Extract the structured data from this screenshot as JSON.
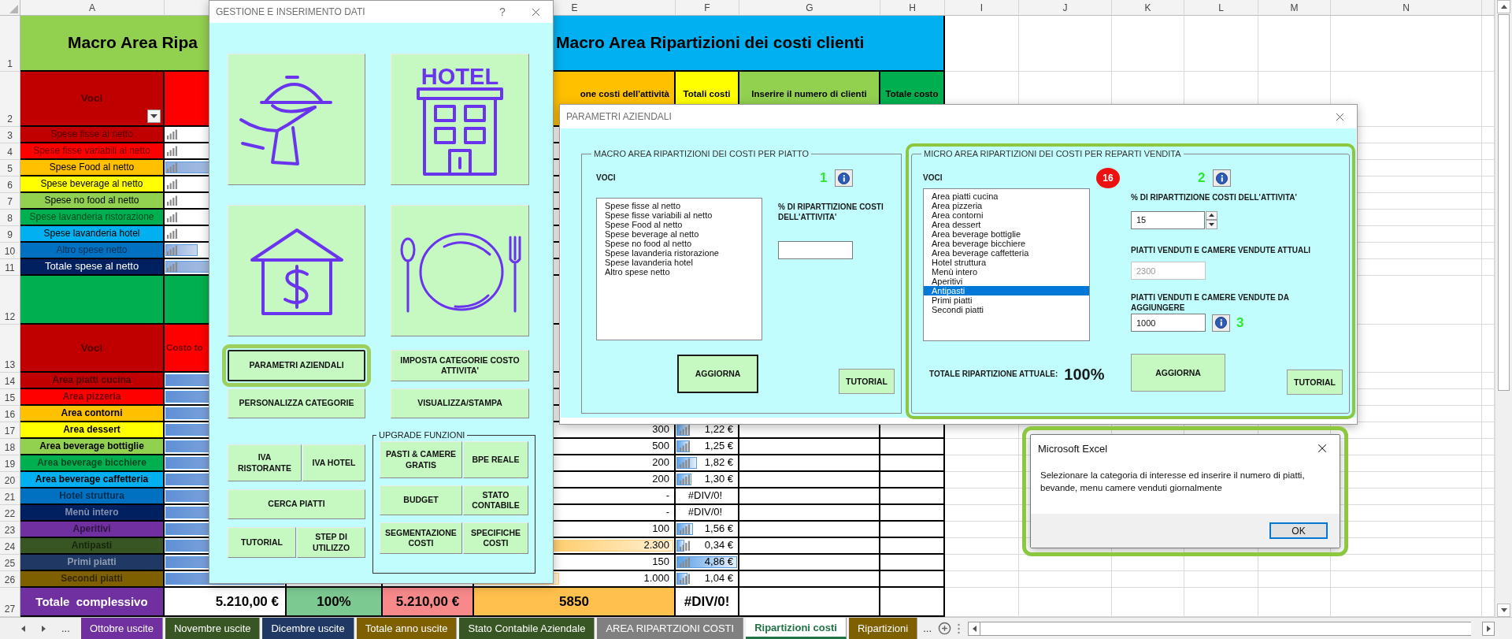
{
  "sheet": {
    "column_headers": {
      "a": "A",
      "e": "E",
      "f": "F",
      "g": "G",
      "h": "H",
      "i": "I",
      "j": "J",
      "k": "K",
      "l": "L",
      "m": "M",
      "n": "N"
    },
    "rows": [
      {
        "number": "1",
        "cells": {
          "a": {
            "kind": "title",
            "text": "Macro Area Ripa",
            "color": "#92d050"
          },
          "b": {
            "color": "#92d050"
          },
          "e": {
            "kind": "title",
            "text": "Macro Area Ripartizioni dei costi clienti",
            "color": "#00b0f0"
          },
          "f": {
            "color": "#00b0f0"
          },
          "g": {
            "color": "#00b0f0"
          },
          "h": {
            "color": "#00b0f0"
          }
        }
      },
      {
        "number": "2",
        "cells": {
          "a": {
            "kind": "head",
            "text": "Voci",
            "color": "#c00000",
            "filter": true
          },
          "b": {
            "color": "#ff0000"
          },
          "e": {
            "kind": "head",
            "text": "one costi dell'attività",
            "color": "#ffc000"
          },
          "f": {
            "kind": "head",
            "text": "Totali costi",
            "color": "#ffff00"
          },
          "g": {
            "kind": "head",
            "text": "Inserire il numero di clienti",
            "color": "#92d050"
          },
          "h": {
            "kind": "head",
            "text": "Totale costo",
            "color": "#00b050"
          }
        }
      },
      {
        "number": "3",
        "cells": {
          "a": {
            "kind": "expense",
            "text": "Spese fisse al netto",
            "color": "#c00000"
          },
          "b": {
            "kind": "bar"
          }
        }
      },
      {
        "number": "4",
        "cells": {
          "a": {
            "kind": "expense",
            "text": "Spese fisse variabili al netto",
            "color": "#ff0000"
          },
          "b": {
            "kind": "bar"
          }
        }
      },
      {
        "number": "5",
        "cells": {
          "a": {
            "kind": "expense",
            "text": "Spese Food al netto",
            "color": "#ffc000"
          },
          "b": {
            "kind": "bar",
            "level": 1
          }
        }
      },
      {
        "number": "6",
        "cells": {
          "a": {
            "kind": "expense",
            "text": "Spese beverage al netto",
            "color": "#ffff00"
          },
          "b": {
            "kind": "bar"
          }
        }
      },
      {
        "number": "7",
        "cells": {
          "a": {
            "kind": "expense",
            "text": "Spese no food al netto",
            "color": "#92d050"
          },
          "b": {
            "kind": "bar"
          }
        }
      },
      {
        "number": "8",
        "cells": {
          "a": {
            "kind": "expense",
            "text": "Spese lavanderia ristorazione",
            "color": "#00b050"
          },
          "b": {
            "kind": "bar"
          }
        }
      },
      {
        "number": "9",
        "cells": {
          "a": {
            "kind": "expense",
            "text": "Spese lavanderia hotel",
            "color": "#00b0f0"
          },
          "b": {
            "kind": "bar"
          }
        }
      },
      {
        "number": "10",
        "cells": {
          "a": {
            "kind": "expense",
            "text": "Altro spese netto",
            "color": "#0070c0"
          },
          "b": {
            "kind": "bar",
            "level": 0.28
          }
        }
      },
      {
        "number": "11",
        "cells": {
          "a": {
            "kind": "total",
            "text": "Totale spese al netto",
            "color": "#002060"
          },
          "b": {
            "kind": "bar",
            "level": 1
          }
        }
      },
      {
        "number": "12",
        "cells": {
          "a": {
            "color": "#00b050"
          },
          "b": {
            "color": "#00b050"
          }
        }
      },
      {
        "number": "13",
        "cells": {
          "a": {
            "kind": "head",
            "text": "Voci",
            "color": "#c00000"
          },
          "b": {
            "kind": "head",
            "text": "Costo to",
            "color": "#ff0000"
          }
        }
      },
      {
        "number": "14",
        "cells": {
          "a": {
            "kind": "area",
            "text": "Area piatti cucina",
            "color": "#c00000"
          },
          "b": {
            "kind": "fill",
            "level": 1
          }
        }
      },
      {
        "number": "15",
        "cells": {
          "a": {
            "kind": "area",
            "text": "Area pizzeria",
            "color": "#ff0000"
          },
          "b": {
            "kind": "fill",
            "level": 1
          }
        }
      },
      {
        "number": "16",
        "cells": {
          "a": {
            "kind": "area",
            "text": "Area contorni",
            "color": "#ffc000"
          },
          "b": {
            "kind": "fill",
            "level": 1
          }
        }
      },
      {
        "number": "17",
        "cells": {
          "a": {
            "kind": "area",
            "text": "Area dessert",
            "color": "#ffff00"
          },
          "b": {
            "kind": "fill",
            "level": 1
          },
          "e": {
            "kind": "number",
            "text": "300"
          },
          "f": {
            "kind": "metric",
            "text": "1,22 €",
            "level": 0.24
          }
        }
      },
      {
        "number": "18",
        "cells": {
          "a": {
            "kind": "area",
            "text": "Area beverage bottiglie",
            "color": "#92d050"
          },
          "b": {
            "kind": "fill",
            "level": 1
          },
          "e": {
            "kind": "number",
            "text": "500"
          },
          "f": {
            "kind": "metric",
            "text": "1,25 €",
            "level": 0.24
          }
        }
      },
      {
        "number": "19",
        "cells": {
          "a": {
            "kind": "area",
            "text": "Area beverage bicchiere",
            "color": "#00b050"
          },
          "b": {
            "kind": "fill",
            "level": 1
          },
          "e": {
            "kind": "number",
            "text": "200"
          },
          "f": {
            "kind": "metric",
            "text": "1,82 €",
            "level": 0.35
          }
        }
      },
      {
        "number": "20",
        "cells": {
          "a": {
            "kind": "area",
            "text": "Area beverage caffetteria",
            "color": "#00b0f0"
          },
          "b": {
            "kind": "fill",
            "level": 1
          },
          "e": {
            "kind": "number",
            "text": "200"
          },
          "f": {
            "kind": "metric",
            "text": "1,30 €",
            "level": 0.26
          }
        }
      },
      {
        "number": "21",
        "cells": {
          "a": {
            "kind": "area",
            "text": "Hotel struttura",
            "color": "#0070c0"
          },
          "b": {
            "kind": "fill",
            "level": 1
          },
          "e": {
            "kind": "number",
            "text": "-"
          },
          "f": {
            "kind": "metric",
            "text": "#DIV/0!"
          }
        }
      },
      {
        "number": "22",
        "cells": {
          "a": {
            "kind": "area",
            "text": "Menù intero",
            "color": "#002060"
          },
          "b": {
            "kind": "fill",
            "level": 1
          },
          "e": {
            "kind": "number",
            "text": "-"
          },
          "f": {
            "kind": "metric",
            "text": "#DIV/0!"
          }
        }
      },
      {
        "number": "23",
        "cells": {
          "a": {
            "kind": "area",
            "text": "Aperitivi",
            "color": "#7030a0"
          },
          "b": {
            "kind": "fill",
            "level": 1
          },
          "e": {
            "kind": "number",
            "text": "100"
          },
          "f": {
            "kind": "metric",
            "text": "1,56 €",
            "level": 0.29
          }
        }
      },
      {
        "number": "24",
        "cells": {
          "a": {
            "kind": "area",
            "text": "Antipasti",
            "color": "#375623"
          },
          "b": {
            "kind": "fill",
            "level": 1
          },
          "e": {
            "kind": "number",
            "text": "2.300",
            "level": 1
          },
          "f": {
            "kind": "metric",
            "text": "0,34 €",
            "level": 0.15
          }
        }
      },
      {
        "number": "25",
        "cells": {
          "a": {
            "kind": "area",
            "text": "Primi piatti",
            "color": "#1f3864"
          },
          "b": {
            "kind": "fill",
            "level": 1
          },
          "e": {
            "kind": "number",
            "text": "150"
          },
          "f": {
            "kind": "metric",
            "text": "4,86 €",
            "level": 1
          }
        }
      },
      {
        "number": "26",
        "cells": {
          "a": {
            "kind": "area",
            "text": "Secondi piatti",
            "color": "#7f6000"
          },
          "b": {
            "kind": "fill",
            "level": 1
          },
          "e": {
            "kind": "number",
            "text": "1.000",
            "level": 0.43
          },
          "f": {
            "kind": "metric",
            "text": "1,04 €",
            "level": 0.2
          }
        }
      },
      {
        "number": "27",
        "cells": {
          "a": {
            "kind": "grand",
            "text": "Totale  complessivo",
            "color": "#7030a0"
          },
          "b": {
            "kind": "grand",
            "text": "5.210,00 €",
            "color": "#ffffff"
          },
          "c": {
            "kind": "grand",
            "text": "100%",
            "color": "#7cc992"
          },
          "d": {
            "kind": "grand",
            "text": "5.210,00 €",
            "color": "#f8898b"
          },
          "e": {
            "kind": "grand",
            "text": "5850",
            "color": "#ffc04d"
          },
          "f": {
            "kind": "grand",
            "text": "#DIV/0!",
            "color": "#ffffff"
          }
        }
      }
    ],
    "more_left": "...",
    "more_right": "...",
    "tabs": [
      {
        "label": "Ottobre uscite",
        "color": "#7030a0",
        "selected": false
      },
      {
        "label": "Novembre uscite",
        "color": "#375623",
        "selected": false
      },
      {
        "label": "Dicembre uscite",
        "color": "#1f3864",
        "selected": false
      },
      {
        "label": "Totale anno uscite",
        "color": "#7f6000",
        "selected": false
      },
      {
        "label": "Stato Contabile Aziendale",
        "color": "#375623",
        "selected": false
      },
      {
        "label": "AREA RIPARTZIONI COSTI",
        "color": "#808080",
        "selected": false
      },
      {
        "label": "Ripartizioni costi",
        "color": "#217346",
        "selected": true
      },
      {
        "label": "Ripartizioni",
        "color": "#7f6000",
        "selected": false
      }
    ]
  },
  "gestione": {
    "title": "GESTIONE E INSERIMENTO DATI",
    "help": "?",
    "tiles": [
      {
        "kind": "waiter"
      },
      {
        "kind": "hotel",
        "label": "HOTEL"
      },
      {
        "kind": "money_house"
      },
      {
        "kind": "tableware"
      }
    ],
    "main_buttons": [
      [
        {
          "label": "PARAMETRI AZIENDALI",
          "highlighted": true
        },
        {
          "label": "IMPOSTA CATEGORIE COSTO ATTIVITA'",
          "highlighted": false
        }
      ],
      [
        {
          "label": "PERSONALIZZA CATEGORIE",
          "highlighted": false
        },
        {
          "label": "VISUALIZZA/STAMPA",
          "highlighted": false
        }
      ]
    ],
    "side_buttons": [
      [
        {
          "label": "IVA RISTORANTE"
        },
        {
          "label": "IVA HOTEL"
        }
      ],
      [
        {
          "label": "CERCA PIATTI"
        }
      ],
      [
        {
          "label": "TUTORIAL"
        },
        {
          "label": "STEP DI UTILIZZO"
        }
      ]
    ],
    "upgrade": {
      "legend": "UPGRADE FUNZIONI",
      "buttons": [
        [
          {
            "label": "PASTI & CAMERE GRATIS"
          },
          {
            "label": "BPE REALE"
          }
        ],
        [
          {
            "label": "BUDGET"
          },
          {
            "label": "STATO CONTABILE"
          }
        ],
        [
          {
            "label": "SEGMENTAZIONE COSTI"
          },
          {
            "label": "SPECIFICHE COSTI"
          }
        ]
      ]
    }
  },
  "parametri": {
    "title": "PARAMETRI AZIENDALI",
    "macro_frame": {
      "legend": "MACRO AREA RIPARTIZIONI DEI COSTI PER PIATTO",
      "highlighted": false,
      "list_label": "VOCI",
      "step": "1",
      "items": [
        {
          "label": "Spese fisse al netto",
          "selected": false
        },
        {
          "label": "Spese fisse variabili al netto",
          "selected": false
        },
        {
          "label": "Spese Food al netto",
          "selected": false
        },
        {
          "label": "Spese beverage al netto",
          "selected": false
        },
        {
          "label": "Spese no food al netto",
          "selected": false
        },
        {
          "label": "Spese lavanderia ristorazione",
          "selected": false
        },
        {
          "label": "Spese lavanderia hotel",
          "selected": false
        },
        {
          "label": "Altro spese netto",
          "selected": false
        }
      ],
      "field_label": "% DI RIPARTTIZIONE COSTI DELL'ATTIVITA'",
      "update_button": {
        "label": "AGGIORNA",
        "focused": true
      },
      "tutorial_button": "TUTORIAL"
    },
    "micro_frame": {
      "legend": "MICRO AREA RIPARTIZIONI DEI COSTI PER REPARTI VENDITA",
      "highlighted": true,
      "list_label": "VOCI",
      "badge": "16",
      "step": "2",
      "items": [
        {
          "label": "Area piatti cucina",
          "selected": false
        },
        {
          "label": "Area pizzeria",
          "selected": false
        },
        {
          "label": "Area contorni",
          "selected": false
        },
        {
          "label": "Area dessert",
          "selected": false
        },
        {
          "label": "Area beverage bottiglie",
          "selected": false
        },
        {
          "label": "Area beverage bicchiere",
          "selected": false
        },
        {
          "label": "Area beverage caffetteria",
          "selected": false
        },
        {
          "label": "Hotel struttura",
          "selected": false
        },
        {
          "label": "Menù intero",
          "selected": false
        },
        {
          "label": "Aperitivi",
          "selected": false
        },
        {
          "label": "Antipasti",
          "selected": true
        },
        {
          "label": "Primi piatti",
          "selected": false
        },
        {
          "label": "Secondi piatti",
          "selected": false
        }
      ],
      "percent_label": "% DI RIPARTTIZIONE COSTI DELL'ATTIVITA'",
      "percent_value": "15",
      "current_label": "PIATTI VENDUTI E CAMERE VENDUTE ATTUALI",
      "current_value": "2300",
      "current_disabled": true,
      "add_label": "PIATTI VENDUTI E CAMERE VENDUTE DA AGGIUNGERE",
      "add_value": "1000",
      "add_step": "3",
      "total_label": "TOTALE RIPARTIZIONE ATTUALE:",
      "total_value": "100%",
      "update_button": {
        "label": "AGGIORNA",
        "focused": false
      },
      "tutorial_button": "TUTORIAL"
    }
  },
  "message_box": {
    "title": "Microsoft Excel",
    "highlighted": true,
    "text": "Selezionare la categoria di interesse ed inserire il numero di piatti, bevande, menu camere venduti giornalmente",
    "button": "OK"
  }
}
